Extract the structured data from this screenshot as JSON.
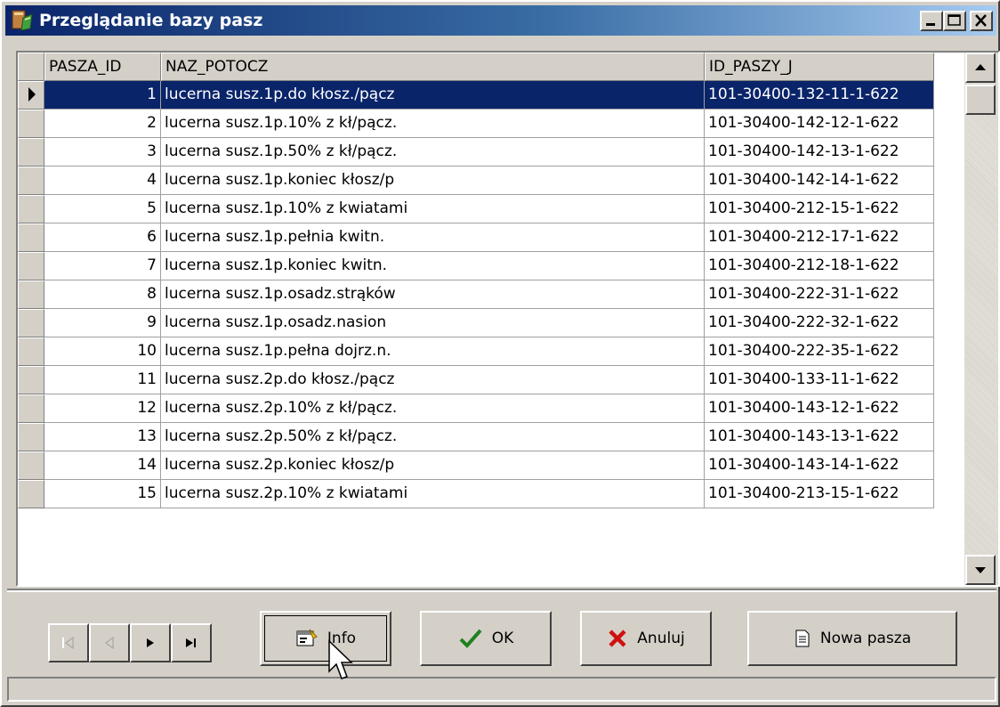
{
  "window": {
    "title": "Przeglądanie bazy pasz"
  },
  "grid": {
    "columns": [
      "PASZA_ID",
      "NAZ_POTOCZ",
      "ID_PASZY_J"
    ],
    "rows": [
      {
        "id": "1",
        "name": "lucerna susz.1p.do kłosz./pącz",
        "code": "101-30400-132-11-1-622"
      },
      {
        "id": "2",
        "name": "lucerna susz.1p.10% z kł/pącz.",
        "code": "101-30400-142-12-1-622"
      },
      {
        "id": "3",
        "name": "lucerna susz.1p.50% z kł/pącz.",
        "code": "101-30400-142-13-1-622"
      },
      {
        "id": "4",
        "name": "lucerna susz.1p.koniec kłosz/p",
        "code": "101-30400-142-14-1-622"
      },
      {
        "id": "5",
        "name": "lucerna susz.1p.10% z kwiatami",
        "code": "101-30400-212-15-1-622"
      },
      {
        "id": "6",
        "name": "lucerna susz.1p.pełnia kwitn.",
        "code": "101-30400-212-17-1-622"
      },
      {
        "id": "7",
        "name": "lucerna susz.1p.koniec kwitn.",
        "code": "101-30400-212-18-1-622"
      },
      {
        "id": "8",
        "name": "lucerna susz.1p.osadz.strąków",
        "code": "101-30400-222-31-1-622"
      },
      {
        "id": "9",
        "name": "lucerna susz.1p.osadz.nasion",
        "code": "101-30400-222-32-1-622"
      },
      {
        "id": "10",
        "name": "lucerna susz.1p.pełna dojrz.n.",
        "code": "101-30400-222-35-1-622"
      },
      {
        "id": "11",
        "name": "lucerna susz.2p.do kłosz./pącz",
        "code": "101-30400-133-11-1-622"
      },
      {
        "id": "12",
        "name": "lucerna susz.2p.10% z kł/pącz.",
        "code": "101-30400-143-12-1-622"
      },
      {
        "id": "13",
        "name": "lucerna susz.2p.50% z kł/pącz.",
        "code": "101-30400-143-13-1-622"
      },
      {
        "id": "14",
        "name": "lucerna susz.2p.koniec kłosz/p",
        "code": "101-30400-143-14-1-622"
      },
      {
        "id": "15",
        "name": "lucerna susz.2p.10% z kwiatami",
        "code": "101-30400-213-15-1-622"
      }
    ],
    "selected_row": 0,
    "selection_color": "#0a246a"
  },
  "buttons": {
    "info": "Info",
    "ok": "OK",
    "cancel": "Anuluj",
    "new_feed": "Nowa pasza"
  },
  "icons": {
    "nav": [
      "first-record-icon",
      "prior-record-icon",
      "next-record-icon",
      "last-record-icon"
    ],
    "ok": "checkmark-icon",
    "cancel": "red-x-icon",
    "info": "properties-icon",
    "new_feed": "document-icon"
  }
}
